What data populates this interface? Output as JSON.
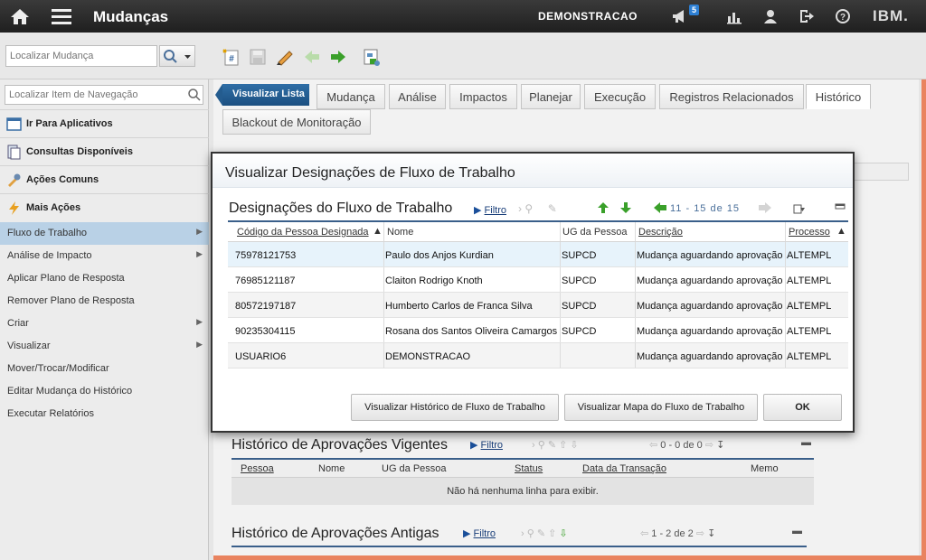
{
  "topbar": {
    "app_title": "Mudanças",
    "user": "DEMONSTRACAO",
    "notifications_count": "5",
    "brand": "IBM."
  },
  "toolbar": {
    "search_placeholder": "Localizar Mudança"
  },
  "sidebar": {
    "search_placeholder": "Localizar Item de Navegação",
    "headers": [
      "Ir Para Aplicativos",
      "Consultas Disponíveis",
      "Ações Comuns",
      "Mais Ações"
    ],
    "items": [
      {
        "label": "Fluxo de Trabalho",
        "arrow": true,
        "selected": true
      },
      {
        "label": "Análise de Impacto",
        "arrow": true
      },
      {
        "label": "Aplicar Plano de Resposta"
      },
      {
        "label": "Remover Plano de Resposta"
      },
      {
        "label": "Criar",
        "arrow": true
      },
      {
        "label": "Visualizar",
        "arrow": true
      },
      {
        "label": "Mover/Trocar/Modificar"
      },
      {
        "label": "Editar Mudança do Histórico"
      },
      {
        "label": "Executar Relatórios"
      }
    ]
  },
  "tabs": {
    "back": "Visualizar Lista",
    "items": [
      "Mudança",
      "Análise",
      "Impactos",
      "Planejar",
      "Execução",
      "Registros Relacionados",
      "Histórico",
      "Blackout de Monitoração"
    ],
    "active": "Histórico"
  },
  "history_current": {
    "title": "Histórico de Aprovações Vigentes",
    "filter": "Filtro",
    "pager": {
      "range": "0 - 0",
      "of": "de",
      "total": "0"
    },
    "columns": [
      "Pessoa",
      "Nome",
      "UG da Pessoa",
      "Status",
      "Data da Transação",
      "Memo"
    ],
    "empty": "Não há nenhuma linha para exibir."
  },
  "history_old": {
    "title": "Histórico de Aprovações Antigas",
    "filter": "Filtro",
    "pager": {
      "range": "1 - 2",
      "of": "de",
      "total": "2"
    }
  },
  "dialog": {
    "title": "Visualizar Designações de Fluxo de Trabalho",
    "section_title": "Designações do Fluxo de Trabalho",
    "filter": "Filtro",
    "pager": {
      "range": "11 - 15",
      "of": "de",
      "total": "15"
    },
    "columns": [
      "Código da Pessoa Designada",
      "Nome",
      "UG da Pessoa",
      "Descrição",
      "Processo"
    ],
    "rows": [
      [
        "75978121753",
        "Paulo dos Anjos Kurdian",
        "SUPCD",
        "Mudança aguardando aprovação",
        "ALTEMPL"
      ],
      [
        "76985121187",
        "Claiton Rodrigo Knoth",
        "SUPCD",
        "Mudança aguardando aprovação",
        "ALTEMPL"
      ],
      [
        "80572197187",
        "Humberto Carlos de Franca Silva",
        "SUPCD",
        "Mudança aguardando aprovação",
        "ALTEMPL"
      ],
      [
        "90235304115",
        "Rosana dos Santos Oliveira Camargos",
        "SUPCD",
        "Mudança aguardando aprovação",
        "ALTEMPL"
      ],
      [
        "USUARIO6",
        "DEMONSTRACAO",
        "",
        "Mudança aguardando aprovação",
        "ALTEMPL"
      ]
    ],
    "buttons": [
      "Visualizar Histórico de Fluxo de Trabalho",
      "Visualizar Mapa do Fluxo de Trabalho",
      "OK"
    ]
  },
  "colors": {
    "accent": "#1b4f80",
    "orange": "#e9835f",
    "highlight_row": "#e7f3fb"
  }
}
